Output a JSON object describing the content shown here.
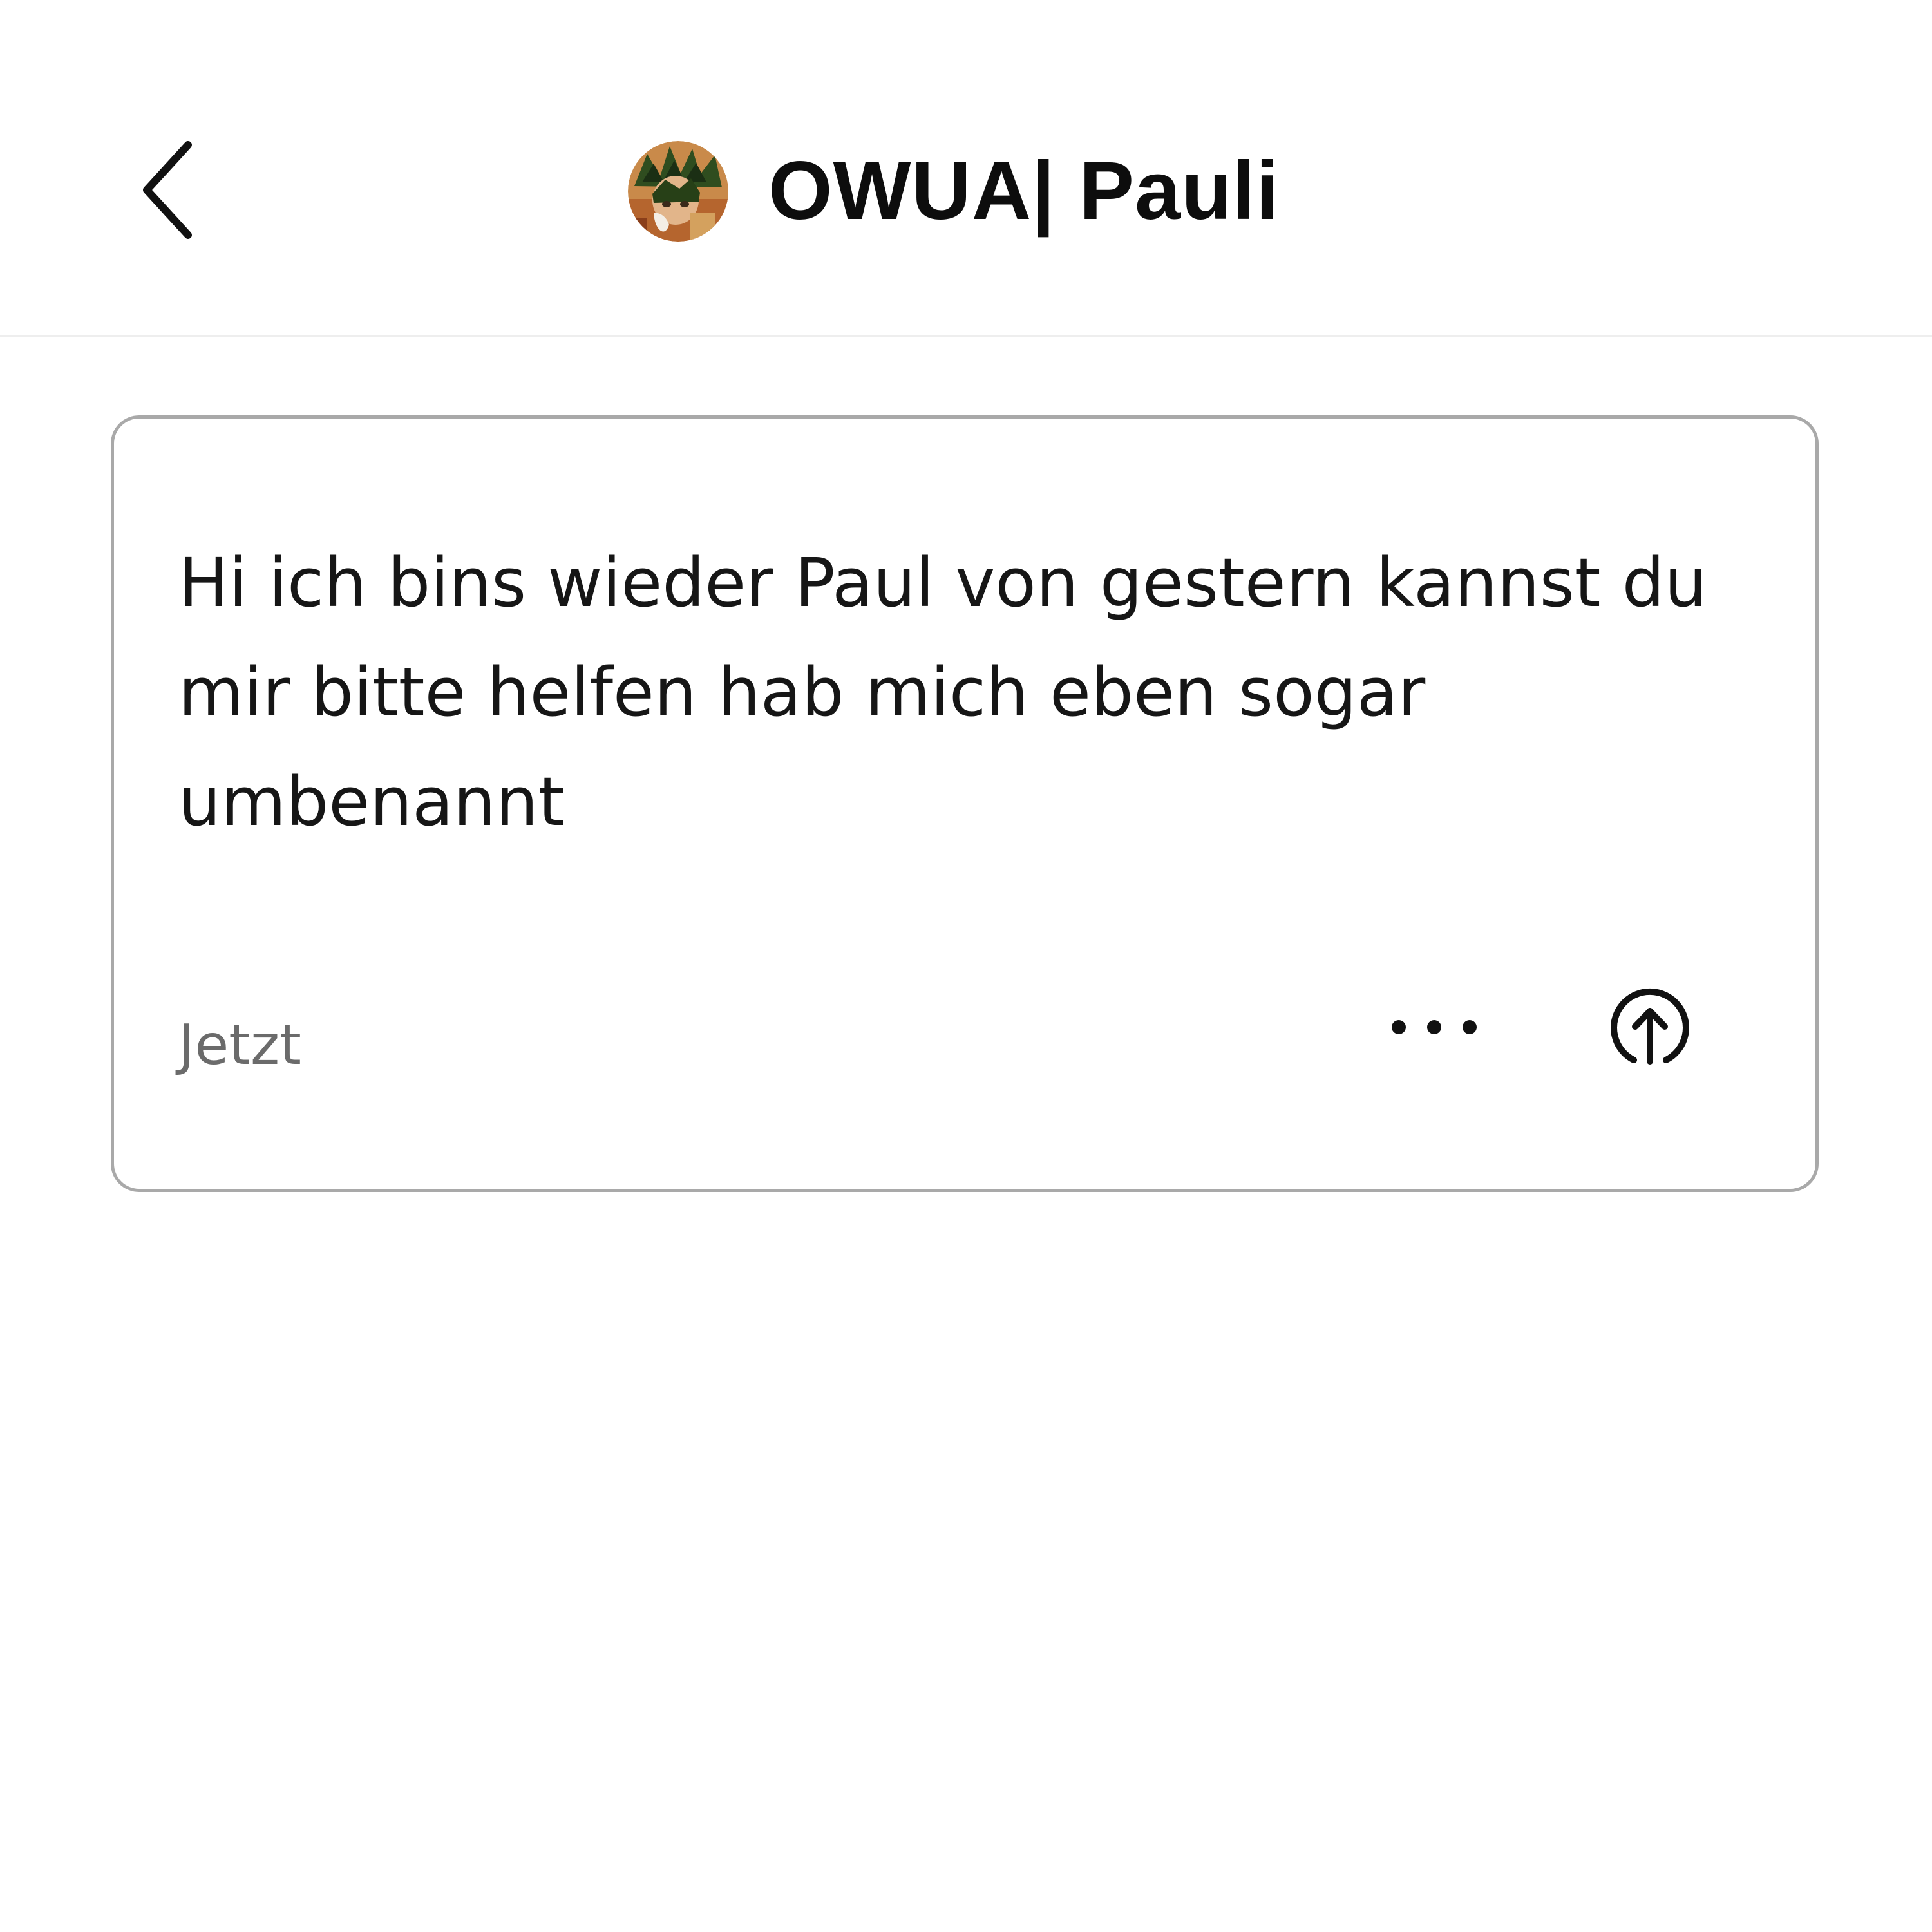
{
  "header": {
    "title": "OWUA| Pauli",
    "back_icon": "chevron-left-icon",
    "avatar_icon": "profile-avatar-image"
  },
  "message": {
    "text": "Hi ich bins wieder Paul von gestern kannst du mir bitte helfen hab mich eben sogar umbenannt",
    "timestamp": "Jetzt",
    "more_icon": "more-horizontal-icon",
    "send_icon": "upload-arrow-circle-icon"
  },
  "colors": {
    "background": "#ffffff",
    "text": "#161616",
    "muted_text": "#6b6b6b",
    "card_border": "#a9a9a9",
    "divider": "#eeeeee"
  }
}
